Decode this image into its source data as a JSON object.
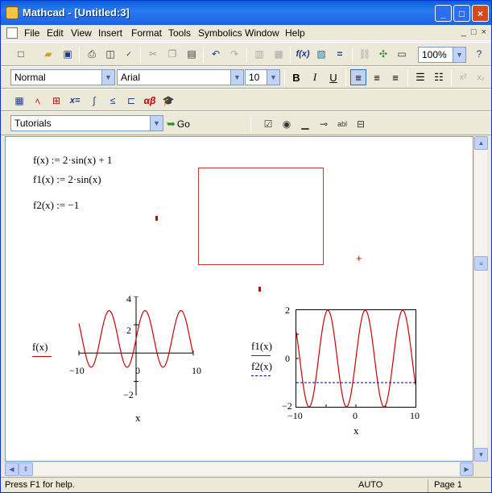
{
  "window": {
    "title": "Mathcad - [Untitled:3]",
    "buttons": [
      "_",
      "□",
      "×"
    ]
  },
  "menu": {
    "items": [
      "File",
      "Edit",
      "View",
      "Insert",
      "Format",
      "Tools",
      "Symbolics",
      "Window",
      "Help"
    ],
    "mdi_buttons": [
      "_",
      "□",
      "×"
    ]
  },
  "toolbar": {
    "zoom": "100%",
    "style": "Normal",
    "font": "Arial",
    "font_size": "10",
    "bold": "B",
    "italic": "I",
    "underline": "U",
    "tutorials": "Tutorials",
    "go": "Go"
  },
  "worksheet": {
    "def_f": "f(x) := 2·sin(x) + 1",
    "def_f1": "f1(x) := 2·sin(x)",
    "def_f2": "f2(x) := −1"
  },
  "plot1": {
    "ylabel": "f(x)",
    "xlabel": "x",
    "xticks": [
      "−10",
      "0",
      "10"
    ],
    "yticks": [
      "4",
      "2",
      "−2"
    ]
  },
  "plot2": {
    "ylabel1": "f1(x)",
    "ylabel2": "f2(x)",
    "xlabel": "x",
    "xticks": [
      "−10",
      "0",
      "10"
    ],
    "yticks": [
      "2",
      "0",
      "−2"
    ]
  },
  "colors": {
    "trace": "#cc0000",
    "trace2": "#000099",
    "frame": "#cc3333"
  },
  "status": {
    "help": "Press F1 for help.",
    "mode": "AUTO",
    "page": "Page 1"
  },
  "chart_data": [
    {
      "type": "line",
      "series": [
        {
          "name": "f(x)",
          "function": "2*sin(x)+1"
        }
      ],
      "x_range": [
        -10,
        10
      ],
      "ylim": [
        -3,
        4
      ],
      "xlabel": "x",
      "ylabel": "f(x)"
    },
    {
      "type": "line",
      "series": [
        {
          "name": "f1(x)",
          "function": "2*sin(x)"
        },
        {
          "name": "f2(x)",
          "function": "-1"
        }
      ],
      "x_range": [
        -10,
        10
      ],
      "ylim": [
        -2,
        2
      ],
      "xlabel": "x",
      "ylabel": "f1(x), f2(x)"
    }
  ]
}
